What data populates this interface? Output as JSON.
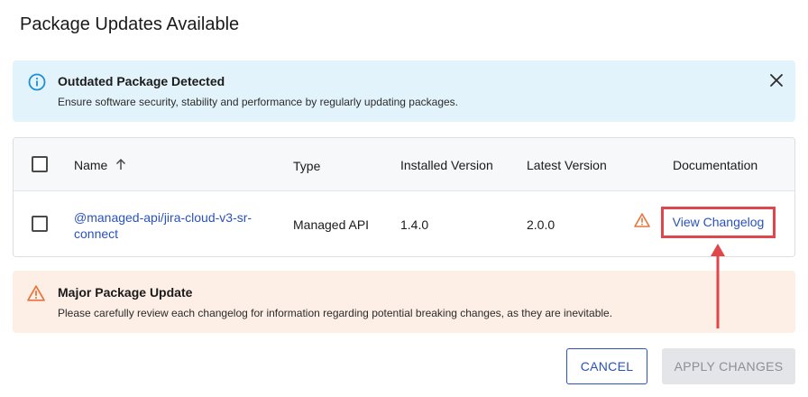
{
  "dialog": {
    "title": "Package Updates Available"
  },
  "info_banner": {
    "icon": "info-icon",
    "title": "Outdated Package Detected",
    "text": "Ensure software security, stability and performance by regularly updating packages.",
    "close_icon": "close-icon",
    "color": "#e3f3fb",
    "icon_color": "#1b8fd1"
  },
  "table": {
    "headers": {
      "name": "Name",
      "type": "Type",
      "installed": "Installed Version",
      "latest": "Latest Version",
      "documentation": "Documentation"
    },
    "sort_icon": "arrow-up-icon",
    "rows": [
      {
        "checked": false,
        "name": "@managed-api/jira-cloud-v3-sr-connect",
        "type": "Managed API",
        "installed": "1.4.0",
        "latest": "2.0.0",
        "warning_icon": "warning-icon",
        "doc_link": "View Changelog"
      }
    ]
  },
  "warning_banner": {
    "icon": "warning-icon",
    "title": "Major Package Update",
    "text": "Please carefully review each changelog for information regarding potential breaking changes, as they are inevitable.",
    "color": "#fdeee6",
    "icon_color": "#e8743b"
  },
  "actions": {
    "cancel": "CANCEL",
    "apply": "APPLY CHANGES",
    "apply_disabled": true
  },
  "accent": {
    "link": "#2a52be",
    "highlight": "#e0474c"
  }
}
